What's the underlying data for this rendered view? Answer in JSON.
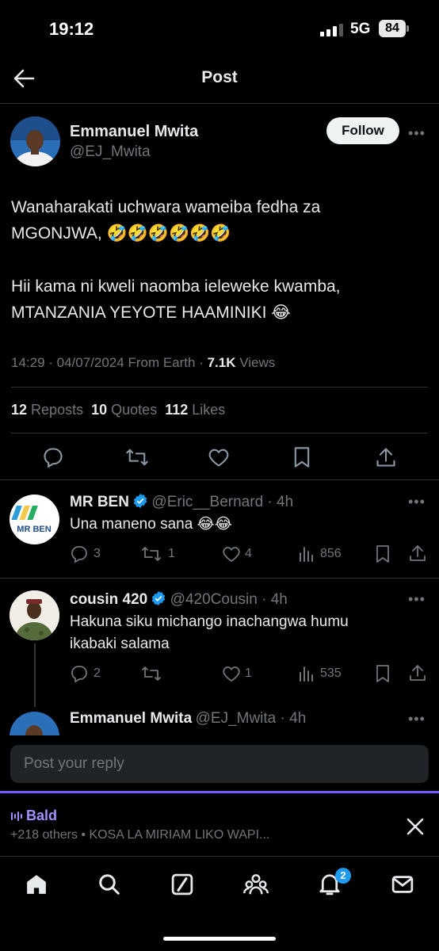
{
  "status_bar": {
    "time": "19:12",
    "network": "5G",
    "battery": "84"
  },
  "header": {
    "title": "Post"
  },
  "post": {
    "author_name": "Emmanuel Mwita",
    "author_handle": "@EJ_Mwita",
    "follow_label": "Follow",
    "text_line1": "Wanaharakati uchwara wameiba fedha za",
    "text_line2": "MGONJWA, 🤣🤣🤣🤣🤣🤣",
    "text_line3": "Hii kama ni kweli naomba ieleweke kwamba,",
    "text_line4": "MTANZANIA YEYOTE HAAMINIKI 😂",
    "timestamp": "14:29 · 04/07/2024 From Earth · ",
    "views_count": "7.1K",
    "views_label": " Views",
    "reposts_count": "12",
    "reposts_label": "Reposts",
    "quotes_count": "10",
    "quotes_label": "Quotes",
    "likes_count": "112",
    "likes_label": "Likes",
    "actions": [
      "reply-icon",
      "repost-icon",
      "like-icon",
      "bookmark-icon",
      "share-icon"
    ]
  },
  "replies": [
    {
      "name": "MR BEN",
      "handle": "@Eric__Bernard · 4h",
      "text": "Una maneno sana 😂😂",
      "avatar_text": "MR BEN",
      "replies": "3",
      "reposts": "1",
      "likes": "4",
      "views": "856"
    },
    {
      "name": "cousin 420",
      "handle": "@420Cousin · 4h",
      "text_line1": "Hakuna siku michango inachangwa humu",
      "text_line2": "ikabaki salama",
      "replies": "2",
      "reposts": "",
      "likes": "1",
      "views": "535"
    },
    {
      "name": "Emmanuel Mwita",
      "handle": "@EJ_Mwita · 4h"
    }
  ],
  "reply_input": {
    "placeholder": "Post your reply"
  },
  "space_bar": {
    "title": "Bald",
    "subtitle": "+218 others • KOSA LA MIRIAM LIKO WAPI..."
  },
  "bottom_nav": {
    "items": [
      "home-icon",
      "search-icon",
      "grok-icon",
      "communities-icon",
      "notifications-icon",
      "messages-icon"
    ],
    "notification_badge": "2"
  },
  "colors": {
    "accent": "#1d9bf0",
    "space": "#7856ff",
    "verified": "#1d9bf0"
  }
}
